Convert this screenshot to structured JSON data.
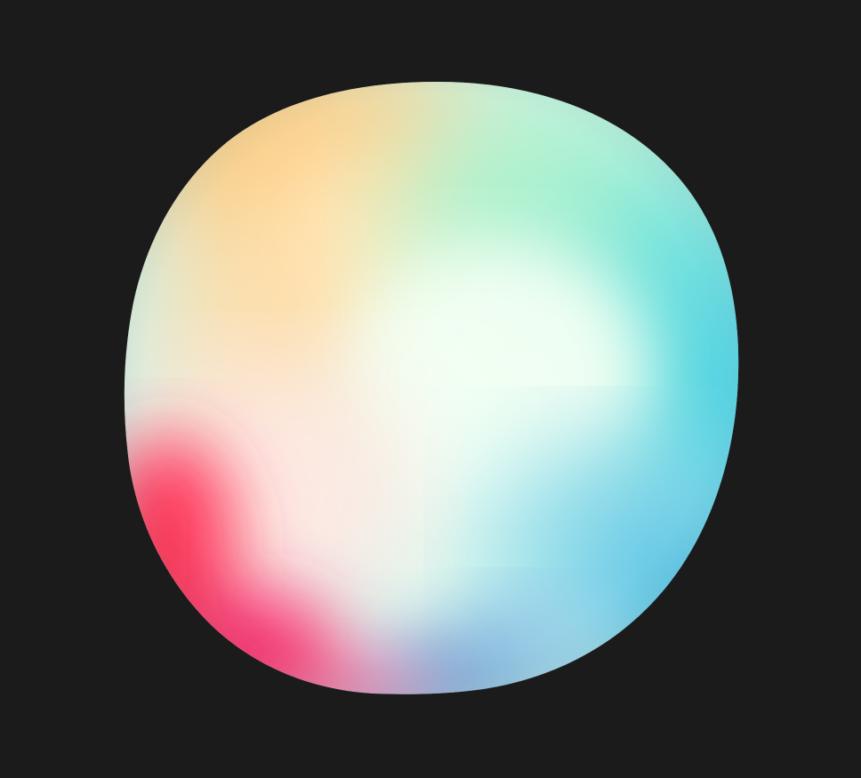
{
  "scene": {
    "background_color": "#1b1b1c",
    "object": "iridescent-orb",
    "palette": {
      "orange": "#ffc46e",
      "cream": "#fff3cf",
      "mint": "#a8f0cf",
      "white_green": "#eefef2",
      "teal": "#74e6dc",
      "cyan": "#2fc7e3",
      "sky": "#63bfe6",
      "navy_blue": "#4f7fc4",
      "pink": "#ff5b8f",
      "red": "#ff2f55",
      "magenta": "#ff2a6e",
      "blush": "#ffe6e2"
    }
  }
}
